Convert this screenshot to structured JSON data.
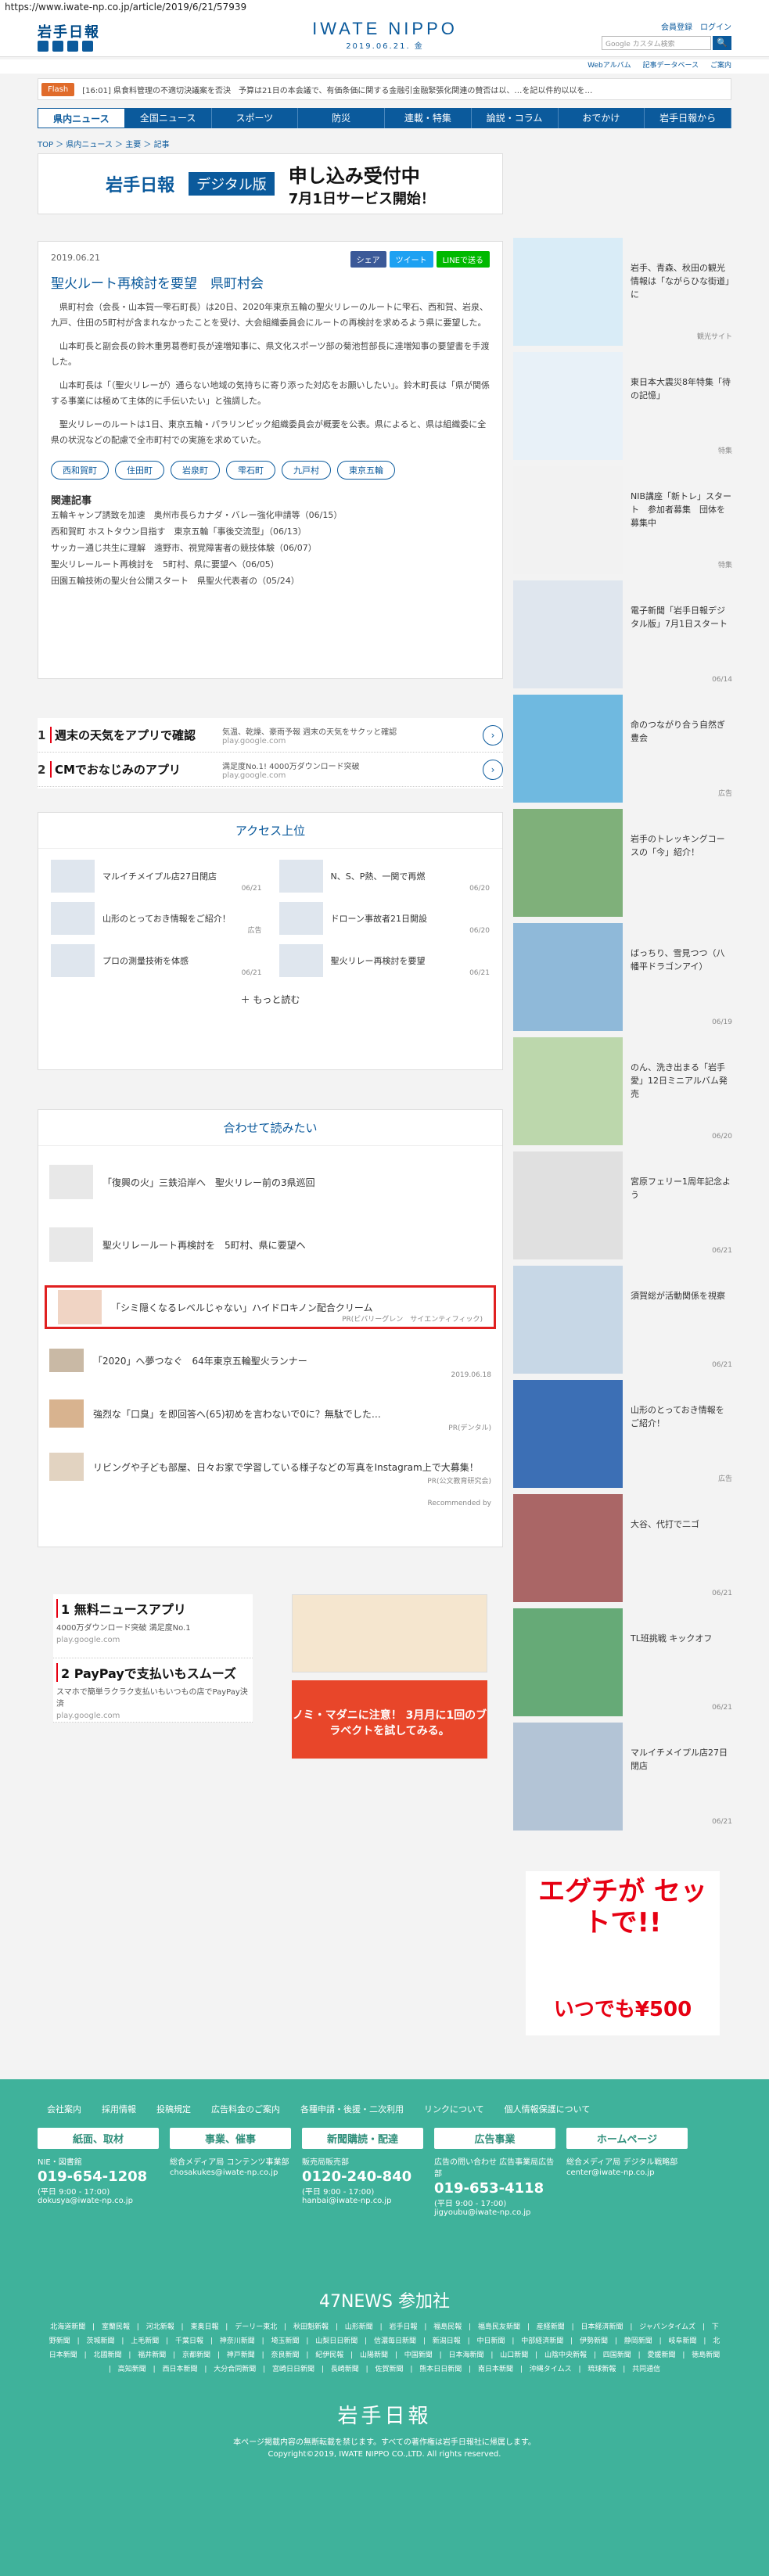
{
  "url": "https://www.iwate-np.co.jp/article/2019/6/21/57939",
  "header": {
    "logo": "岩手日報",
    "center_name": "IWATE NIPPO",
    "center_date": "2019.06.21. 金",
    "links": [
      "会員登録",
      "ログイン"
    ],
    "search_placeholder": "Google カスタム検索",
    "search_button": "🔍",
    "subnav": [
      "Webアルバム",
      "記事データベース",
      "ご案内"
    ]
  },
  "flash": {
    "label": "Flash",
    "text": "[16:01] 県食料管理の不適切決議案を否決　予算は21日の本会議で、有価条価に関する金融引金融緊張化関連の賛否は以、…を記以件約以以を…"
  },
  "nav": [
    "県内ニュース",
    "全国ニュース",
    "スポーツ",
    "防災",
    "連載・特集",
    "論説・コラム",
    "おでかけ",
    "岩手日報から"
  ],
  "breadcrumb": "TOP ＞ 県内ニュース ＞ 主要 ＞ 記事",
  "banner": {
    "t1": "岩手日報",
    "t2": "デジタル版",
    "t3": "申し込み受付中",
    "t4": "7月1日サービス開始！"
  },
  "article": {
    "date": "2019.06.21",
    "share": [
      "シェア",
      "ツイート",
      "LINEで送る"
    ],
    "title": "聖火ルート再検討を要望　県町村会",
    "paragraphs": [
      "県町村会（会長・山本賀一雫石町長）は20日、2020年東京五輪の聖火リレーのルートに雫石、西和賀、岩泉、九戸、住田の5町村が含まれなかったことを受け、大会組織委員会にルートの再検討を求めるよう県に要望した。",
      "山本町長と副会長の鈴木重男葛巻町長が達増知事に、県文化スポーツ部の菊池哲部長に達増知事の要望書を手渡した。",
      "山本町長は「（聖火リレーが）通らない地域の気持ちに寄り添った対応をお願いしたい」。鈴木町長は「県が関係する事業には極めて主体的に手伝いたい」と強調した。",
      "聖火リレーのルートは1日、東京五輪・パラリンピック組織委員会が概要を公表。県によると、県は組織委に全県の状況などの配慮で全市町村での実施を求めていた。"
    ],
    "tags": [
      "西和賀町",
      "住田町",
      "岩泉町",
      "雫石町",
      "九戸村",
      "東京五輪"
    ],
    "related_heading": "関連記事",
    "related": [
      "五輪キャンプ誘致を加速　奥州市長らカナダ・バレー強化申請等（06/15）",
      "西和賀町 ホストタウン目指す　東京五輪「事後交流型」（06/13）",
      "サッカー通じ共生に理解　遠野市、視覚障害者の競技体験（06/07）",
      "聖火リレールート再検討を　5町村、県に要望へ（06/05）",
      "田園五輪技術の聖火台公開スタート　県聖火代表者の（05/24）"
    ]
  },
  "ads": [
    {
      "num": "1",
      "title": "週末の天気をアプリで確認",
      "desc": "気温、乾燥、豪雨予報 週末の天気をサクッと確認",
      "url": "play.google.com"
    },
    {
      "num": "2",
      "title": "CMでおなじみのアプリ",
      "desc": "満足度No.1! 4000万ダウンロード突破",
      "url": "play.google.com"
    }
  ],
  "access": {
    "heading": "アクセス上位",
    "items": [
      {
        "title": "マルイチメイプル店27日閉店",
        "date": "06/21"
      },
      {
        "title": "N、S、P熱、一関で再燃",
        "date": "06/20"
      },
      {
        "title": "山形のとっておき情報をご紹介！",
        "date": "広告"
      },
      {
        "title": "ドローン事故者21日開設",
        "date": "06/20"
      },
      {
        "title": "プロの測量技術を体感",
        "date": "06/21"
      },
      {
        "title": "聖火リレー再検討を要望",
        "date": "06/21"
      }
    ],
    "more": "もっと読む"
  },
  "together": {
    "heading": "合わせて読みたい",
    "items": [
      {
        "title": "「復興の火」三鉄沿岸へ　聖火リレー前の3県巡回",
        "meta": ""
      },
      {
        "title": "聖火リレールート再検討を　5町村、県に要望へ",
        "meta": ""
      },
      {
        "title": "「シミ隠くなるレベルじゃない」ハイドロキノン配合クリーム",
        "meta": "PR(ビバリーグレン　サイエンティフィック)"
      },
      {
        "title": "「2020」へ夢つなぐ　64年東京五輪聖火ランナー",
        "meta": "2019.06.18"
      },
      {
        "title": "強烈な「口臭」を即回答へ(65)初めを言わないで0に？無駄でした…",
        "meta": "PR(デンタル)"
      },
      {
        "title": "リビングや子ども部屋、日々お家で学習している様子などの写真をInstagram上で大募集！",
        "meta": "PR(公文教育研究会)"
      }
    ],
    "recommend": "Recommended by"
  },
  "bottom_ads": [
    {
      "num": "1",
      "title": "無料ニュースアプリ",
      "desc": "4000万ダウンロード突破 満足度No.1",
      "url": "play.google.com"
    },
    {
      "num": "2",
      "title": "PayPayで支払いもスムーズ",
      "desc": "スマホで簡単ラクラク支払いもいつもの店でPayPay決済",
      "url": "play.google.com"
    }
  ],
  "bottom_ad_right": "ノミ・マダニに注意！ 3月月に1回のブラベクトを試してみる。",
  "sidebar": [
    {
      "title": "岩手、青森、秋田の観光情報は「ながらひな街道」に",
      "meta": "観光サイト",
      "color": "#d9ecf7"
    },
    {
      "title": "東日本大震災8年特集「待の記憶」",
      "meta": "特集",
      "color": "#e8f1f8"
    },
    {
      "title": "NIB講座「新トレ」スタート　参加者募集　団体を募集中",
      "meta": "特集",
      "color": "#f2f2f2"
    },
    {
      "title": "電子新聞「岩手日報デジタル版」7月1日スタート",
      "meta": "06/14",
      "color": "#dfe6ee"
    },
    {
      "title": "命のつながり合う自然ぎ豊会",
      "meta": "広告",
      "color": "#6fb9e0"
    },
    {
      "title": "岩手のトレッキングコースの「今」紹介！",
      "meta": "",
      "color": "#7fb07a"
    },
    {
      "title": "ばっちり、雪見つつ（八幡平ドラゴンアイ）",
      "meta": "06/19",
      "color": "#8fb9d9"
    },
    {
      "title": "のん、洗き出まる「岩手愛」12日ミニアルバム発売",
      "meta": "06/20",
      "color": "#bcd7ac"
    },
    {
      "title": "宮原フェリー1周年記念よう",
      "meta": "06/21",
      "color": "#e0e0e0"
    },
    {
      "title": "須賀総が活動関係を視察",
      "meta": "06/21",
      "color": "#c7d7e6"
    },
    {
      "title": "山形のとっておき情報をご紹介！",
      "meta": "広告",
      "color": "#3c6fb5"
    },
    {
      "title": "大谷、代打で二ゴ",
      "meta": "06/21",
      "color": "#a66"
    },
    {
      "title": "TL班挑戦 キックオフ",
      "meta": "06/21",
      "color": "#6a7"
    },
    {
      "title": "マルイチメイプル店27日閉店",
      "meta": "06/21",
      "color": "#b3c4d6"
    }
  ],
  "sidebar_ad": {
    "t1": "エグチが セットで!!",
    "t2": "いつでも¥500"
  },
  "footer": {
    "links": [
      "会社案内",
      "採用情報",
      "投稿規定",
      "広告料金のご案内",
      "各種申請・後援・二次利用",
      "リンクについて",
      "個人情報保護について"
    ],
    "cols": [
      {
        "head": "紙面、取材",
        "sub": "NIE・図書館",
        "phone": "019-654-1208",
        "hours": "(平日 9:00 - 17:00)",
        "mail": "dokusya@iwate-np.co.jp"
      },
      {
        "head": "事業、催事",
        "sub": "総合メディア局 コンテンツ事業部",
        "phone": "",
        "hours": "",
        "mail": "chosakukes@iwate-np.co.jp"
      },
      {
        "head": "新聞購読・配達",
        "sub": "販売局販売部",
        "phone": "0120-240-840",
        "hours": "(平日 9:00 - 17:00)",
        "mail": "hanbai@iwate-np.co.jp"
      },
      {
        "head": "広告事業",
        "sub": "広告の問い合わせ 広告事業局広告部",
        "phone": "019-653-4118",
        "hours": "(平日 9:00 - 17:00)",
        "mail": "jigyoubu@iwate-np.co.jp"
      },
      {
        "head": "ホームページ",
        "sub": "総合メディア局 デジタル戦略部",
        "phone": "",
        "hours": "",
        "mail": "center@iwate-np.co.jp"
      }
    ],
    "news47_title": "47NEWS 参加社",
    "news_list": "北海道新聞 | 室蘭民報 | 河北新報 | 東奥日報 | デーリー東北 | 秋田魁新報 | 山形新聞 | 岩手日報 | 福島民報 | 福島民友新聞 | 産経新聞 | 日本経済新聞 | ジャパンタイムズ | 下野新聞 | 茨城新聞 | 上毛新聞 | 千葉日報 | 神奈川新聞 | 埼玉新聞 | 山梨日日新聞 | 信濃毎日新聞 | 新潟日報 | 中日新聞 | 中部経済新聞 | 伊勢新聞 | 静岡新聞 | 岐阜新聞 | 北日本新聞 | 北國新聞 | 福井新聞 | 京都新聞 | 神戸新聞 | 奈良新聞 | 紀伊民報 | 山陽新聞 | 中国新聞 | 日本海新聞 | 山口新聞 | 山陰中央新報 | 四国新聞 | 愛媛新聞 | 徳島新聞 | 高知新聞 | 西日本新聞 | 大分合同新聞 | 宮崎日日新聞 | 長崎新聞 | 佐賀新聞 | 熊本日日新聞 | 南日本新聞 | 沖縄タイムス | 琉球新報 | 共同通信",
    "logo": "岩手日報",
    "note": "本ページ掲載内容の無断転載を禁じます。すべての著作権は岩手日報社に帰属します。",
    "copy": "Copyright©2019, IWATE NIPPO CO.,LTD. All rights reserved."
  }
}
